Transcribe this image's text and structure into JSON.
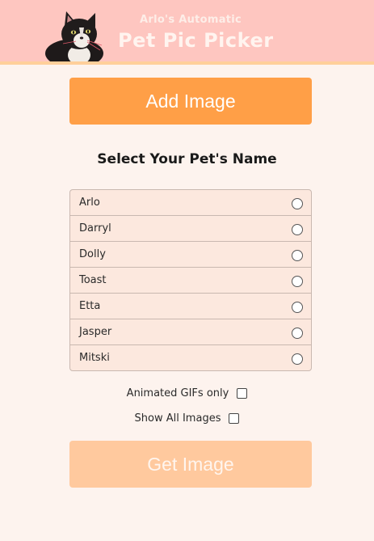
{
  "header": {
    "subtitle": "Arlo's Automatic",
    "title": "Pet Pic Picker"
  },
  "actions": {
    "add_image": "Add Image",
    "get_image": "Get Image"
  },
  "pet_select": {
    "heading": "Select Your Pet's Name",
    "pets": [
      "Arlo",
      "Darryl",
      "Dolly",
      "Toast",
      "Etta",
      "Jasper",
      "Mitski"
    ],
    "selected": null
  },
  "filters": {
    "gif_label": "Animated GIFs only",
    "gif_checked": false,
    "all_label": "Show All Images",
    "all_checked": false
  },
  "colors": {
    "header_bg": "#fec6c0",
    "header_border": "#ffcf9a",
    "page_bg": "#fdf3ee",
    "add_button": "#ff9f47",
    "get_button_disabled": "#ffc99e",
    "list_bg": "#fce8de"
  }
}
